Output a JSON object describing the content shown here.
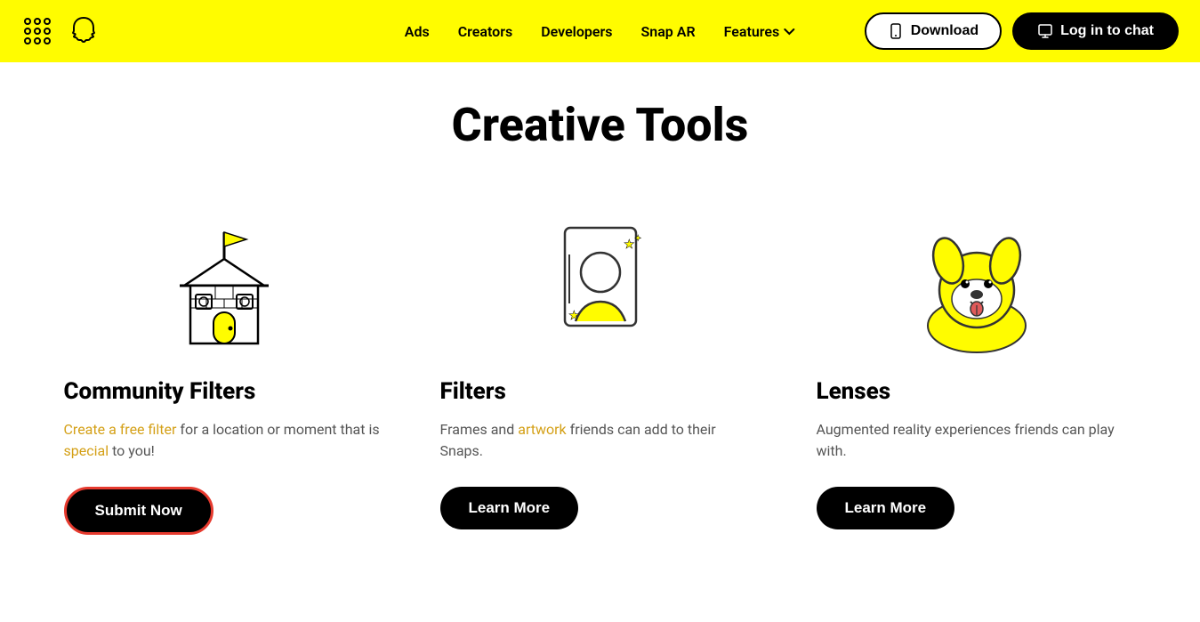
{
  "navbar": {
    "nav_links": [
      {
        "label": "Ads",
        "id": "ads"
      },
      {
        "label": "Creators",
        "id": "creators"
      },
      {
        "label": "Developers",
        "id": "developers"
      },
      {
        "label": "Snap AR",
        "id": "snap-ar"
      },
      {
        "label": "Features",
        "id": "features",
        "has_chevron": true
      }
    ],
    "download_label": "Download",
    "login_label": "Log in to chat"
  },
  "main": {
    "title": "Creative Tools",
    "cards": [
      {
        "id": "community-filters",
        "title": "Community Filters",
        "description": "Create a free filter for a location or moment that is special to you!",
        "button_label": "Submit Now",
        "button_type": "submit"
      },
      {
        "id": "filters",
        "title": "Filters",
        "description": "Frames and artwork friends can add to their Snaps.",
        "button_label": "Learn More",
        "button_type": "learn"
      },
      {
        "id": "lenses",
        "title": "Lenses",
        "description": "Augmented reality experiences friends can play with.",
        "button_label": "Learn More",
        "button_type": "learn"
      }
    ]
  },
  "icons": {
    "grid": "⊞",
    "phone": "📱",
    "monitor": "🖥"
  }
}
